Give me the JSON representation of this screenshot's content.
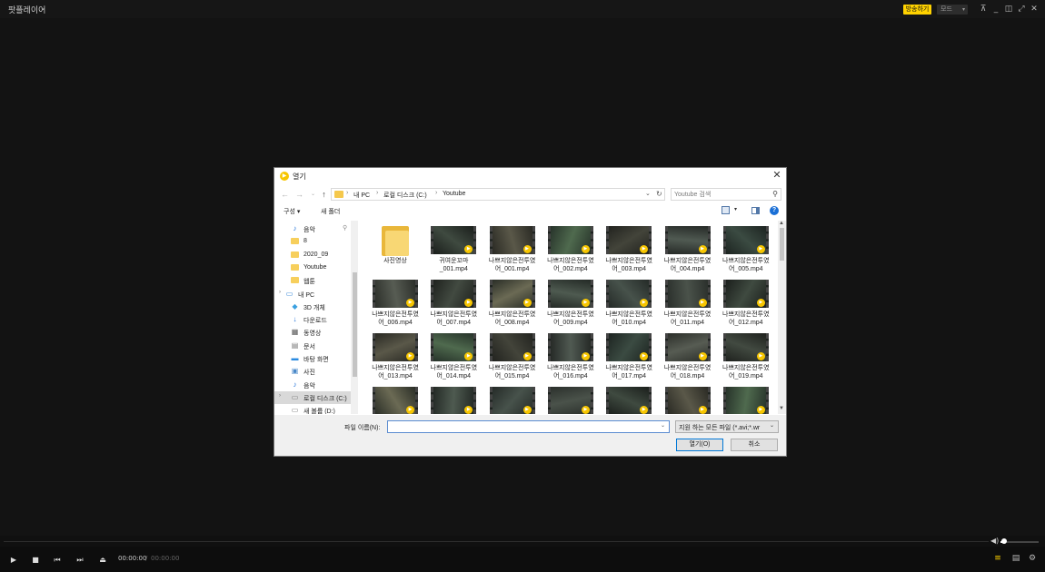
{
  "app": {
    "title": "팟플레이어",
    "broadcast_label": "방송하기",
    "mode_label": "모드",
    "window_controls": [
      "pin-icon",
      "minimize-icon",
      "restore-icon",
      "maximize-icon",
      "close-icon"
    ]
  },
  "player": {
    "time_current": "00:00:00",
    "time_separator": "/",
    "time_total": "00:00:00",
    "volume_level": 0.1,
    "controls": [
      "play-icon",
      "stop-icon",
      "previous-icon",
      "next-icon",
      "eject-icon"
    ],
    "right_controls": [
      "playlist-icon",
      "chapter-icon",
      "settings-icon"
    ]
  },
  "dialog": {
    "title": "열기",
    "breadcrumb": [
      "내 PC",
      "로컬 디스크 (C:)",
      "Youtube"
    ],
    "search_placeholder": "Youtube 검색",
    "toolbar": {
      "organize": "구성",
      "new_folder": "새 폴더"
    },
    "nav_items": [
      {
        "label": "음악",
        "icon": "music-icon"
      },
      {
        "label": "8",
        "icon": "folder-icon"
      },
      {
        "label": "2020_09",
        "icon": "folder-icon"
      },
      {
        "label": "Youtube",
        "icon": "folder-icon"
      },
      {
        "label": "웹툰",
        "icon": "folder-icon"
      },
      {
        "label": "내 PC",
        "icon": "computer-icon"
      },
      {
        "label": "3D 개체",
        "icon": "cube-icon"
      },
      {
        "label": "다운로드",
        "icon": "download-icon"
      },
      {
        "label": "동영상",
        "icon": "video-icon"
      },
      {
        "label": "문서",
        "icon": "document-icon"
      },
      {
        "label": "바탕 화면",
        "icon": "desktop-icon"
      },
      {
        "label": "사진",
        "icon": "picture-icon"
      },
      {
        "label": "음악",
        "icon": "music-icon"
      },
      {
        "label": "로컬 디스크 (C:)",
        "icon": "drive-icon"
      },
      {
        "label": "새 볼륨 (D:)",
        "icon": "drive-icon"
      }
    ],
    "files": [
      {
        "name": "사진영상",
        "kind": "folder"
      },
      {
        "name": "귀여운꼬마_001.mp4",
        "kind": "video"
      },
      {
        "name": "나쁘지않은전투였어_001.mp4",
        "kind": "video"
      },
      {
        "name": "나쁘지않은전투였어_002.mp4",
        "kind": "video"
      },
      {
        "name": "나쁘지않은전투였어_003.mp4",
        "kind": "video"
      },
      {
        "name": "나쁘지않은전투였어_004.mp4",
        "kind": "video"
      },
      {
        "name": "나쁘지않은전투였어_005.mp4",
        "kind": "video"
      },
      {
        "name": "나쁘지않은전투였어_006.mp4",
        "kind": "video"
      },
      {
        "name": "나쁘지않은전투였어_007.mp4",
        "kind": "video"
      },
      {
        "name": "나쁘지않은전투였어_008.mp4",
        "kind": "video"
      },
      {
        "name": "나쁘지않은전투였어_009.mp4",
        "kind": "video"
      },
      {
        "name": "나쁘지않은전투였어_010.mp4",
        "kind": "video"
      },
      {
        "name": "나쁘지않은전투였어_011.mp4",
        "kind": "video"
      },
      {
        "name": "나쁘지않은전투였어_012.mp4",
        "kind": "video"
      },
      {
        "name": "나쁘지않은전투였어_013.mp4",
        "kind": "video"
      },
      {
        "name": "나쁘지않은전투였어_014.mp4",
        "kind": "video"
      },
      {
        "name": "나쁘지않은전투였어_015.mp4",
        "kind": "video"
      },
      {
        "name": "나쁘지않은전투였어_016.mp4",
        "kind": "video"
      },
      {
        "name": "나쁘지않은전투였어_017.mp4",
        "kind": "video"
      },
      {
        "name": "나쁘지않은전투였어_018.mp4",
        "kind": "video"
      },
      {
        "name": "나쁘지않은전투였어_019.mp4",
        "kind": "video"
      },
      {
        "name": "",
        "kind": "video"
      },
      {
        "name": "",
        "kind": "video"
      },
      {
        "name": "",
        "kind": "video"
      },
      {
        "name": "",
        "kind": "video"
      },
      {
        "name": "",
        "kind": "video"
      },
      {
        "name": "",
        "kind": "video"
      },
      {
        "name": "",
        "kind": "video"
      }
    ],
    "filename_label": "파일 이름(N):",
    "filename_value": "",
    "filetype_value": "지원 하는 모든 파일 (*.avi;*.wr",
    "open_label": "열기(O)",
    "cancel_label": "취소"
  },
  "colors": {
    "accent": "#ffd200",
    "player_bg": "#131313",
    "dialog_bg": "#ffffff"
  }
}
